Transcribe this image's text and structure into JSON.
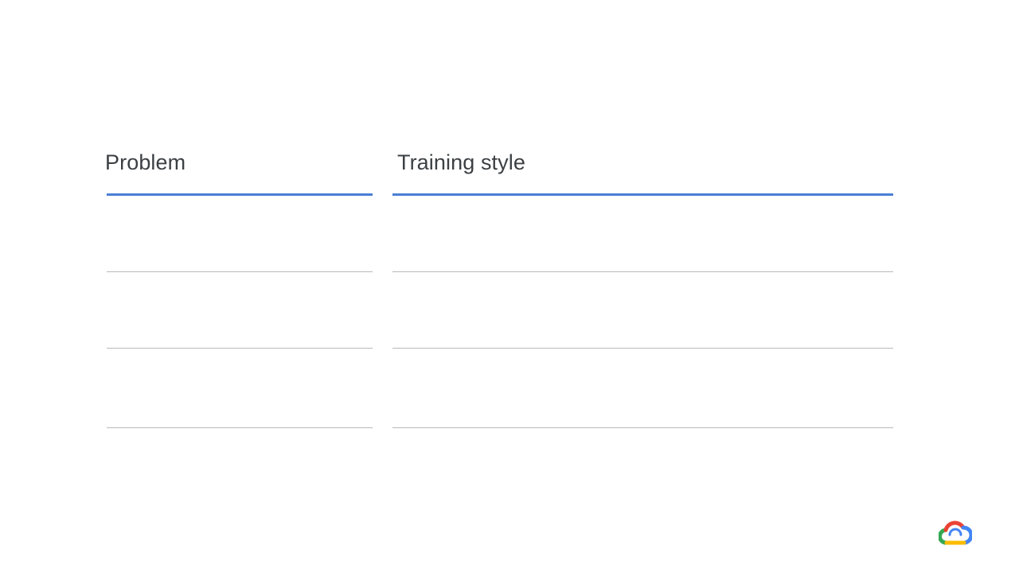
{
  "table": {
    "columns": [
      {
        "header": "Problem",
        "rows": [
          "",
          "",
          ""
        ]
      },
      {
        "header": "Training style",
        "rows": [
          "",
          "",
          ""
        ]
      }
    ],
    "header_rule_color": "#4a7fd4",
    "row_rule_color": "#b9b9b9"
  },
  "logo": {
    "icon": "google-cloud-logo-icon"
  }
}
